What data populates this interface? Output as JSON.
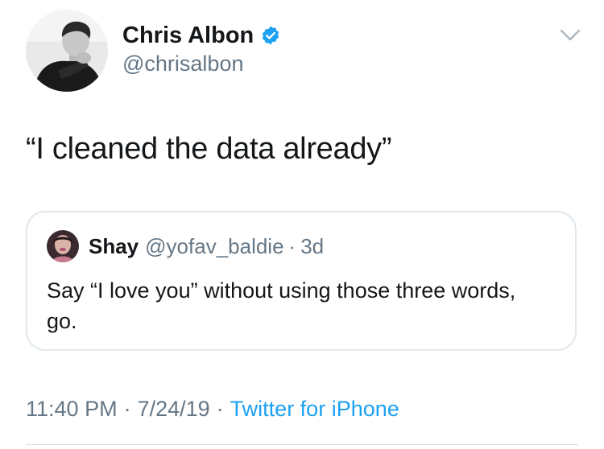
{
  "author": {
    "display_name": "Chris Albon",
    "handle": "@chrisalbon",
    "verified": true,
    "avatar_icon": "profile-photo"
  },
  "tweet": {
    "text": "“I cleaned the data already”"
  },
  "quoted_tweet": {
    "display_name": "Shay",
    "handle": "@yofav_baldie",
    "separator": "·",
    "time_ago": "3d",
    "text": "Say “I love you” without using those three words, go."
  },
  "meta": {
    "time": "11:40 PM",
    "date": "7/24/19",
    "separator": "·",
    "source": "Twitter for iPhone"
  },
  "colors": {
    "text": "#14171a",
    "secondary": "#657786",
    "link": "#1da1f2",
    "border": "#e1e8ed",
    "verified": "#1da1f2"
  }
}
